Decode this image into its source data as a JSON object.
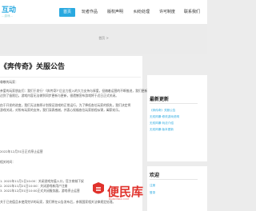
{
  "header": {
    "logo_main": "互动",
    "logo_sub": "…游戏…",
    "nav": [
      "首页",
      "玩者作品",
      "版权声明",
      "纠纷处理",
      "许可制度",
      "联系我们"
    ]
  },
  "breadcrumb": "首页 >",
  "article": {
    "title": "《奔传奇》关服公告",
    "paragraphs": [
      "尊敬的玩家：",
      "亲爱的玩家朋友们：我们于发行”《奔传奇》”后全力投入的大力支持与厚爱，但随着运营的不断推进，我们更新的力度",
      "达到了极限后，游戏内容无法做到同步更新与更新，很遗憾宣布游戏将于近日正式关闭。",
      "由于开发的进度，我们无法按原计划保证游戏的正常运行，为了降低各位玩家的损失，我们决定将",
      "游戏关闭，对所有玩家的支持，我们深表感谢，并衷心祝福各位玩家前程似锦，阖家欢乐。",
      "2022年12月31日正式停止运营",
      "相关时间：",
      "1. 2022年11月1日10:00：关闭游戏充值入口，官方商城下架",
      "2. 2022年11月21日10:00：关闭游戏新用户注册",
      "3. 2022年12月31日10:00正式关闭服务器，游戏停止运营",
      "关于已充值且未使用完毕的玩家，我们将在公告发布后，参照国家相关法律规定处理。"
    ]
  },
  "sidebar": {
    "latest_title": "最新更新",
    "latest_links": [
      "《奔传奇》关服公告",
      "无双风暴·修改游戏说明",
      "无双风暴·玩法介绍",
      "无双风暴·版本更新"
    ],
    "welcome_title": "欢迎",
    "welcome_links": [
      "注册",
      "登录"
    ]
  },
  "watermark": {
    "text": "便民库",
    "sub": "BIANMINKU.COM"
  }
}
